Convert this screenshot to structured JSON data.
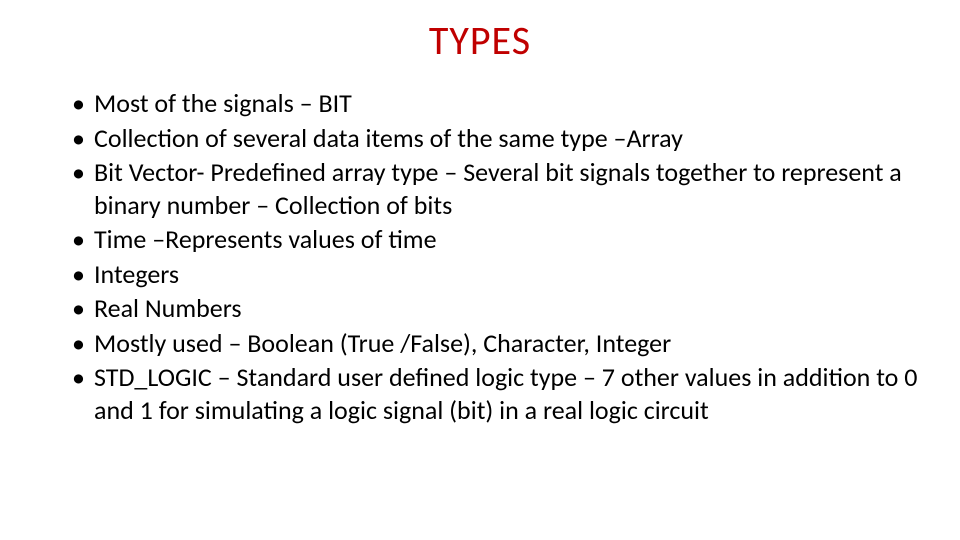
{
  "title": "TYPES",
  "bullets": [
    "Most of the signals – BIT",
    "Collection of several data items of the same type –Array",
    "Bit Vector- Predefined array type – Several bit signals together to represent a binary number – Collection of bits",
    "Time –Represents values of time",
    "Integers",
    "Real Numbers",
    "Mostly used – Boolean (True /False), Character, Integer",
    "STD_LOGIC – Standard user defined  logic type – 7 other values in addition to 0 and 1 for simulating a logic signal (bit) in a real logic circuit"
  ]
}
